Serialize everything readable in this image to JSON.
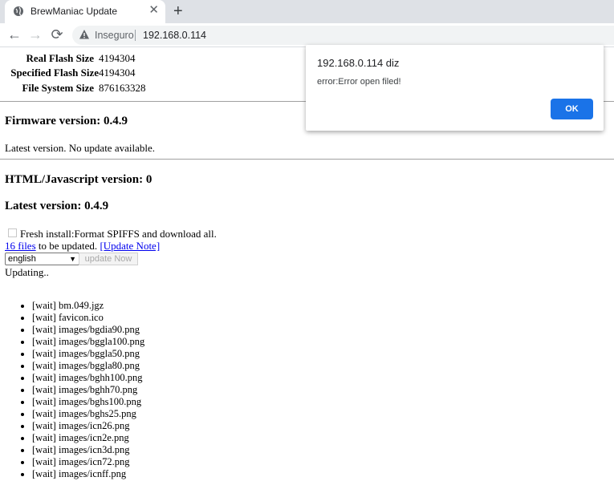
{
  "browser": {
    "tab_title": "BrewManiac Update",
    "tab_close": "✕",
    "new_tab": "+",
    "back": "←",
    "forward": "→",
    "reload": "⟳",
    "security_label": "Inseguro",
    "url": "192.168.0.114"
  },
  "info": {
    "rows": [
      {
        "label": "Real Flash Size",
        "value": "4194304"
      },
      {
        "label": "Specified Flash Size",
        "value": "4194304"
      },
      {
        "label": "File System Size",
        "value": "876163328"
      }
    ]
  },
  "firmware": {
    "heading": "Firmware version: 0.4.9",
    "status": "Latest version. No update available."
  },
  "html": {
    "heading": "HTML/Javascript version: 0",
    "latest_heading": "Latest version: 0.4.9",
    "fresh_install_label": "Fresh install:Format SPIFFS and download all.",
    "files_link": "16 files",
    "files_suffix": "to be updated.",
    "update_note_link": "[Update Note]",
    "language_selected": "english",
    "update_button": "update Now",
    "updating_text": "Updating.."
  },
  "files": [
    "[wait] bm.049.jgz",
    "[wait] favicon.ico",
    "[wait] images/bgdia90.png",
    "[wait] images/bggla100.png",
    "[wait] images/bggla50.png",
    "[wait] images/bggla80.png",
    "[wait] images/bghh100.png",
    "[wait] images/bghh70.png",
    "[wait] images/bghs100.png",
    "[wait] images/bghs25.png",
    "[wait] images/icn26.png",
    "[wait] images/icn2e.png",
    "[wait] images/icn3d.png",
    "[wait] images/icn72.png",
    "[wait] images/icnff.png"
  ],
  "dialog": {
    "title": "192.168.0.114 diz",
    "message": "error:Error open filed!",
    "ok_label": "OK"
  }
}
